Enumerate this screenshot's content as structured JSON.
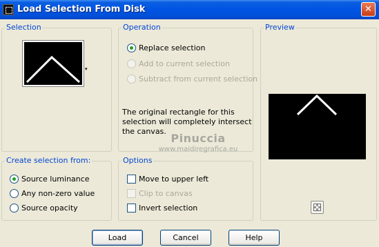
{
  "window": {
    "title": "Load Selection From Disk",
    "close_glyph": "✕",
    "accent_color": "#0054e3"
  },
  "selection": {
    "title": "Selection",
    "dropdown_glyph": "▾"
  },
  "operation": {
    "title": "Operation",
    "options": [
      {
        "label": "Replace selection",
        "checked": true,
        "enabled": true
      },
      {
        "label": "Add to current selection",
        "checked": false,
        "enabled": false
      },
      {
        "label": "Subtract from current selection",
        "checked": false,
        "enabled": false
      }
    ],
    "info": "The original rectangle for this selection will completely intersect the canvas."
  },
  "preview": {
    "title": "Preview",
    "checker_icon": "checkerboard-icon"
  },
  "create_from": {
    "title": "Create selection from:",
    "options": [
      {
        "label": "Source luminance",
        "checked": true
      },
      {
        "label": "Any non-zero value",
        "checked": false
      },
      {
        "label": "Source opacity",
        "checked": false
      }
    ]
  },
  "options": {
    "title": "Options",
    "items": [
      {
        "label": "Move to upper left",
        "checked": false,
        "enabled": true
      },
      {
        "label": "Clip to canvas",
        "checked": false,
        "enabled": false
      },
      {
        "label": "Invert selection",
        "checked": false,
        "enabled": true
      }
    ]
  },
  "watermark": {
    "name": "Pinuccia",
    "url": "www.maidiregrafica.eu"
  },
  "buttons": {
    "load": "Load",
    "cancel": "Cancel",
    "help": "Help"
  }
}
